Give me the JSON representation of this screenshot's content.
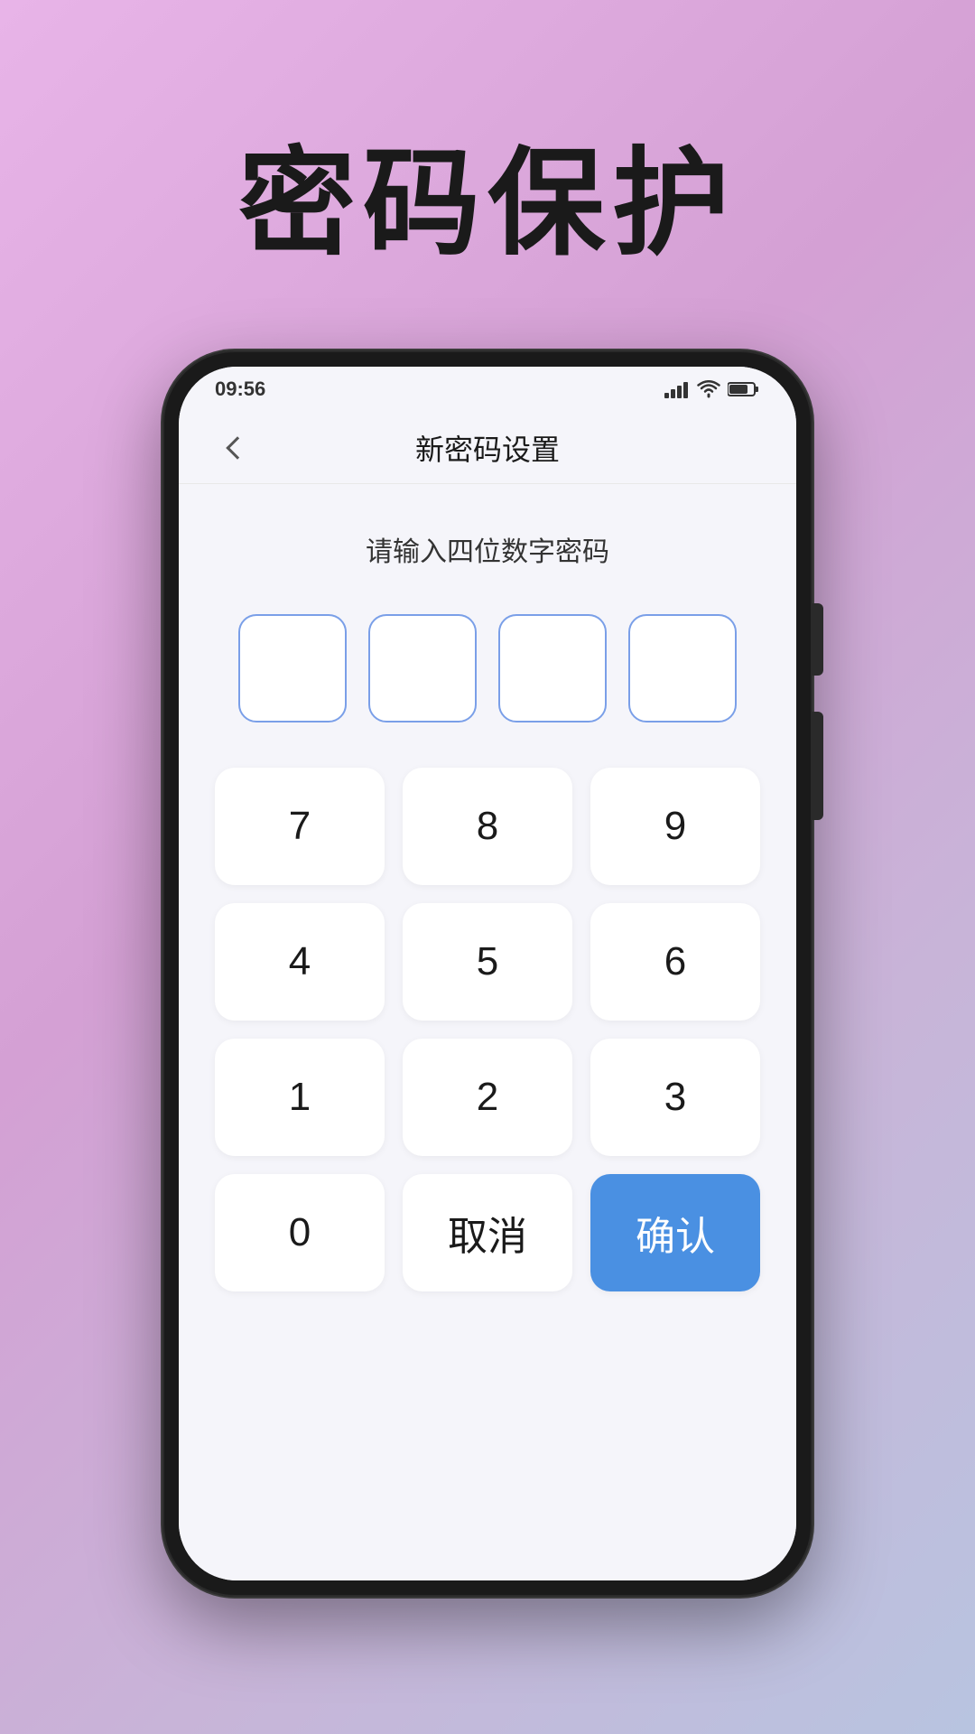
{
  "page": {
    "title": "密码保护",
    "background_gradient_start": "#e8b4e8",
    "background_gradient_end": "#b8c4e0"
  },
  "status_bar": {
    "time": "09:56",
    "icons": "信号 WiFi 电池"
  },
  "nav": {
    "title": "新密码设置",
    "back_label": "返回"
  },
  "password_section": {
    "instruction": "请输入四位数字密码",
    "pin_count": 4
  },
  "numpad": {
    "rows": [
      [
        "7",
        "8",
        "9"
      ],
      [
        "4",
        "5",
        "6"
      ],
      [
        "1",
        "2",
        "3"
      ],
      [
        "0",
        "取消",
        "确认"
      ]
    ],
    "cancel_label": "取消",
    "confirm_label": "确认"
  }
}
